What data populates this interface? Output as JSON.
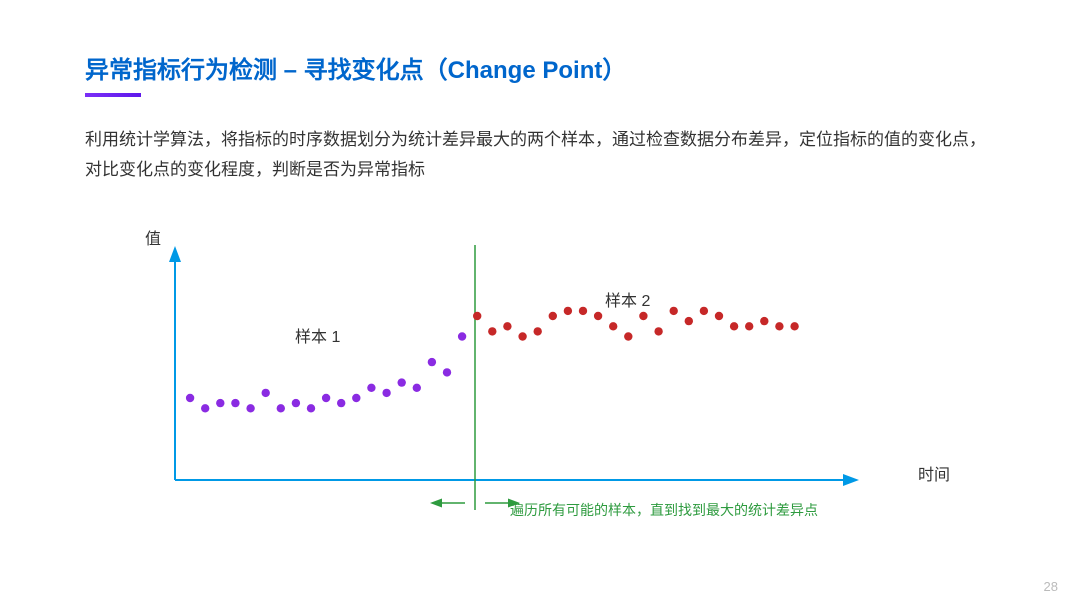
{
  "title": "异常指标行为检测  –  寻找变化点（Change Point）",
  "description": "利用统计学算法，将指标的时序数据划分为统计差异最大的两个样本，通过检查数据分布差异，定位指标的值的变化点，对比变化点的变化程度，判断是否为异常指标",
  "chart": {
    "y_axis_label": "值",
    "x_axis_label": "时间",
    "sample1_label": "样本 1",
    "sample2_label": "样本 2",
    "footer_note": "遍历所有可能的样本，直到找到最大的统计差异点"
  },
  "page_number": "28",
  "chart_data": {
    "type": "scatter",
    "title": "Change Point Detection",
    "xlabel": "时间",
    "ylabel": "值",
    "series": [
      {
        "name": "样本 1",
        "color": "#8a2be2",
        "x": [
          1,
          2,
          3,
          4,
          5,
          6,
          7,
          8,
          9,
          10,
          11,
          12,
          13,
          14,
          15,
          16,
          17,
          18,
          19
        ],
        "y": [
          16,
          14,
          15,
          15,
          14,
          17,
          14,
          15,
          14,
          16,
          15,
          16,
          18,
          17,
          19,
          18,
          23,
          21,
          28
        ]
      },
      {
        "name": "样本 2",
        "color": "#c62828",
        "x": [
          20,
          21,
          22,
          23,
          24,
          25,
          26,
          27,
          28,
          29,
          30,
          31,
          32,
          33,
          34,
          35,
          36,
          37,
          38,
          39,
          40,
          41
        ],
        "y": [
          32,
          29,
          30,
          28,
          29,
          32,
          33,
          33,
          32,
          30,
          28,
          32,
          29,
          33,
          31,
          33,
          32,
          30,
          30,
          31,
          30,
          30
        ]
      }
    ],
    "change_point_x": 19.5,
    "ylim": [
      0,
      40
    ],
    "xlim": [
      0,
      45
    ]
  }
}
